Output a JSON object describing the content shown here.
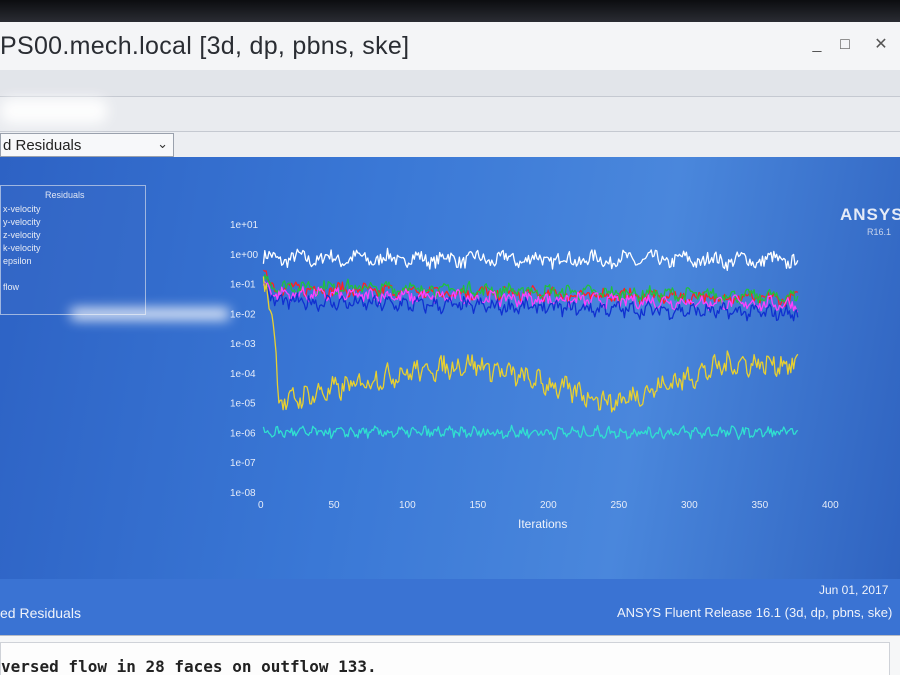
{
  "window": {
    "title": "PS00.mech.local  [3d, dp, pbns, ske]",
    "minimize_label": "_",
    "maximize_label": "□",
    "close_label": "✕"
  },
  "display_selector": {
    "value": "d Residuals",
    "chevron_icon": "chevron-down-icon"
  },
  "legend": {
    "title": "Residuals",
    "items": [
      {
        "label": "x-velocity",
        "color": "#ff2020"
      },
      {
        "label": "y-velocity",
        "color": "#20c040"
      },
      {
        "label": "z-velocity",
        "color": "#1030d0"
      },
      {
        "label": "k-velocity",
        "color": "#ff40ff"
      },
      {
        "label": "epsilon",
        "color": "#30e0d0"
      },
      {
        "label": "flow",
        "color": "#e8d030"
      }
    ]
  },
  "brand": {
    "name": "ANSYS",
    "version": "R16.1"
  },
  "chart_data": {
    "type": "line",
    "xlabel": "Iterations",
    "xlim": [
      0,
      400
    ],
    "x_ticks": [
      "0",
      "50",
      "100",
      "150",
      "200",
      "250",
      "300",
      "350",
      "400"
    ],
    "y_scale": "log",
    "ylim": [
      1e-08,
      10
    ],
    "y_ticks": [
      "1e+01",
      "1e+00",
      "1e-01",
      "1e-02",
      "1e-03",
      "1e-04",
      "1e-05",
      "1e-06",
      "1e-07",
      "1e-08"
    ],
    "iterations_shown": 380,
    "series": [
      {
        "color": "#ffffff",
        "levels": [
          [
            0,
            0.7
          ],
          [
            380,
            0.6
          ]
        ],
        "noise": 0.22
      },
      {
        "color": "#ff2020",
        "levels": [
          [
            0,
            0.2
          ],
          [
            10,
            0.07
          ],
          [
            60,
            0.06
          ],
          [
            380,
            0.03
          ]
        ],
        "noise": 0.18
      },
      {
        "color": "#20c040",
        "levels": [
          [
            0,
            0.15
          ],
          [
            10,
            0.08
          ],
          [
            100,
            0.07
          ],
          [
            380,
            0.035
          ]
        ],
        "noise": 0.18
      },
      {
        "color": "#ff40ff",
        "levels": [
          [
            0,
            0.1
          ],
          [
            10,
            0.045
          ],
          [
            380,
            0.02
          ]
        ],
        "noise": 0.18
      },
      {
        "color": "#1030d0",
        "levels": [
          [
            0,
            0.08
          ],
          [
            10,
            0.025
          ],
          [
            380,
            0.01
          ]
        ],
        "noise": 0.2
      },
      {
        "color": "#e8d030",
        "levels": [
          [
            0,
            0.1
          ],
          [
            8,
            0.01
          ],
          [
            12,
            1e-05
          ],
          [
            100,
            0.0001
          ],
          [
            150,
            0.0002
          ],
          [
            250,
            1e-05
          ],
          [
            330,
            0.0002
          ],
          [
            380,
            0.0002
          ]
        ],
        "noise": 0.3
      },
      {
        "color": "#30e0d0",
        "levels": [
          [
            0,
            1e-06
          ],
          [
            380,
            1e-06
          ]
        ],
        "noise": 0.15
      }
    ]
  },
  "footer": {
    "left_label": "ed Residuals",
    "date": "Jun 01, 2017",
    "release": "ANSYS Fluent Release 16.1 (3d, dp, pbns, ske)"
  },
  "console": {
    "line": "versed flow in 28 faces on outflow 133."
  }
}
